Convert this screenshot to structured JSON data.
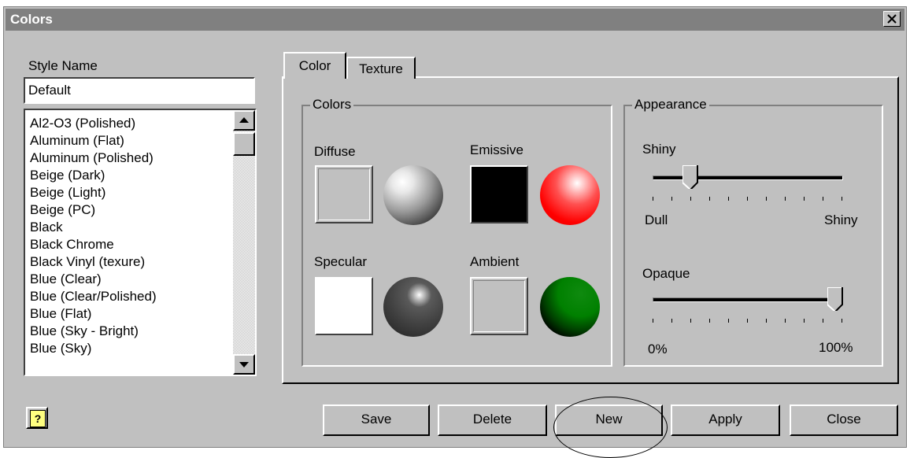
{
  "window": {
    "title": "Colors"
  },
  "style_name": {
    "label": "Style Name",
    "value": "Default"
  },
  "style_list": {
    "items": [
      "Al2-O3 (Polished)",
      "Aluminum (Flat)",
      "Aluminum (Polished)",
      "Beige (Dark)",
      "Beige (Light)",
      "Beige (PC)",
      "Black",
      "Black Chrome",
      "Black Vinyl (texure)",
      "Blue (Clear)",
      "Blue (Clear/Polished)",
      "Blue (Flat)",
      "Blue (Sky - Bright)",
      "Blue (Sky)"
    ]
  },
  "tabs": [
    {
      "label": "Color",
      "active": true
    },
    {
      "label": "Texture",
      "active": false
    }
  ],
  "colors_group": {
    "caption": "Colors",
    "diffuse": {
      "label": "Diffuse",
      "swatch": "#c0c0c0"
    },
    "emissive": {
      "label": "Emissive",
      "swatch": "#000000"
    },
    "specular": {
      "label": "Specular",
      "swatch": "#ffffff"
    },
    "ambient": {
      "label": "Ambient",
      "swatch": "#c0c0c0"
    }
  },
  "appearance_group": {
    "caption": "Appearance",
    "shiny": {
      "label": "Shiny",
      "min_label": "Dull",
      "max_label": "Shiny",
      "value_fraction": 0.2
    },
    "opaque": {
      "label": "Opaque",
      "min_label": "0%",
      "max_label": "100%",
      "value_fraction": 1.0
    }
  },
  "buttons": {
    "save": "Save",
    "delete": "Delete",
    "new": "New",
    "apply": "Apply",
    "close": "Close",
    "help_glyph": "?"
  }
}
